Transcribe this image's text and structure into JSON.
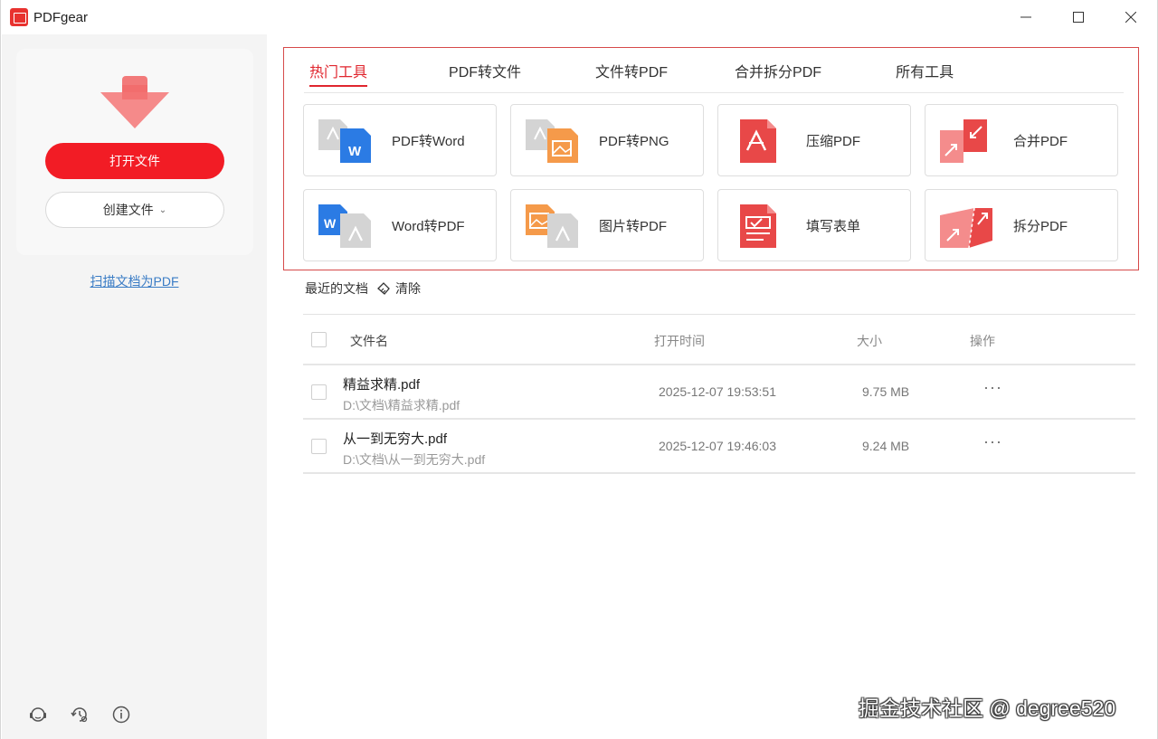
{
  "window": {
    "title": "PDFgear"
  },
  "sidebar": {
    "open_label": "打开文件",
    "create_label": "创建文件",
    "scan_label": "扫描文档为PDF",
    "bottom_icons": [
      "support-icon",
      "history-settings-icon",
      "info-icon"
    ]
  },
  "tabs": [
    {
      "label": "热门工具",
      "active": true
    },
    {
      "label": "PDF转文件",
      "active": false
    },
    {
      "label": "文件转PDF",
      "active": false
    },
    {
      "label": "合并拆分PDF",
      "active": false
    },
    {
      "label": "所有工具",
      "active": false
    }
  ],
  "tools": [
    {
      "label": "PDF转Word",
      "icon": "pdf-to-word-icon"
    },
    {
      "label": "PDF转PNG",
      "icon": "pdf-to-png-icon"
    },
    {
      "label": "压缩PDF",
      "icon": "compress-pdf-icon"
    },
    {
      "label": "合并PDF",
      "icon": "merge-pdf-icon"
    },
    {
      "label": "Word转PDF",
      "icon": "word-to-pdf-icon"
    },
    {
      "label": "图片转PDF",
      "icon": "image-to-pdf-icon"
    },
    {
      "label": "填写表单",
      "icon": "fill-form-icon"
    },
    {
      "label": "拆分PDF",
      "icon": "split-pdf-icon"
    }
  ],
  "recent": {
    "title": "最近的文档",
    "clear_label": "清除",
    "columns": {
      "name": "文件名",
      "time": "打开时间",
      "size": "大小",
      "ops": "操作"
    },
    "rows": [
      {
        "name": "精益求精.pdf",
        "path": "D:\\文档\\精益求精.pdf",
        "time": "2025-12-07 19:53:51",
        "size": "9.75 MB",
        "more": "···"
      },
      {
        "name": "从一到无穷大.pdf",
        "path": "D:\\文档\\从一到无穷大.pdf",
        "time": "2025-12-07 19:46:03",
        "size": "9.24 MB",
        "more": "···"
      }
    ]
  },
  "watermark": "掘金技术社区 @ degree520",
  "colors": {
    "accent": "#f21c25",
    "tab_active": "#e0262e",
    "link": "#3a7cc5",
    "box_border": "#d64a4a"
  }
}
